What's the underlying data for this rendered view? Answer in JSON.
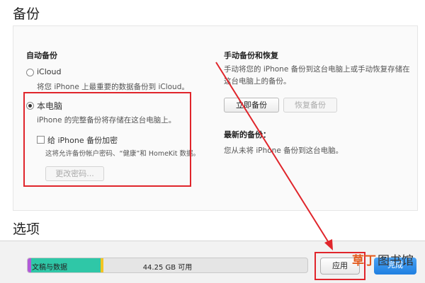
{
  "backup": {
    "section_title": "备份",
    "auto": {
      "heading": "自动备份",
      "icloud_label": "iCloud",
      "icloud_desc": "将您 iPhone 上最重要的数据备份到 iCloud。",
      "computer_label": "本电脑",
      "computer_desc": "iPhone 的完整备份将存储在这台电脑上。",
      "encrypt_label": "给 iPhone 备份加密",
      "encrypt_desc": "这将允许备份帐户密码、“健康”和 HomeKit 数据。",
      "change_password_button": "更改密码...",
      "selected_option": "本电脑",
      "encrypt_checked": false
    },
    "manual": {
      "heading": "手动备份和恢复",
      "desc_line1": "手动将您的 iPhone 备份到这台电脑上或手动恢复存储在",
      "desc_line2": "这台电脑上的备份。",
      "backup_now_button": "立即备份",
      "restore_button": "恢复备份"
    },
    "latest": {
      "heading": "最新的备份：",
      "desc": "您从未将 iPhone 备份到这台电脑。"
    }
  },
  "options": {
    "section_title": "选项"
  },
  "bottom_bar": {
    "storage": {
      "segment_label": "文稿与数据",
      "available_text": "44.25 GB 可用",
      "documents_fraction": 0.26,
      "other_fraction": 0.01
    },
    "apply_button": "应用",
    "done_button": "完成"
  },
  "watermark": {
    "text_a": "草丁",
    "text_b": "图书馆"
  },
  "colors": {
    "annotation_red": "#e0252b",
    "storage_documents": "#2fc7a7",
    "storage_purple": "#b25ad8",
    "storage_other": "#f2c522",
    "done_blue": "#1f7fe0"
  }
}
